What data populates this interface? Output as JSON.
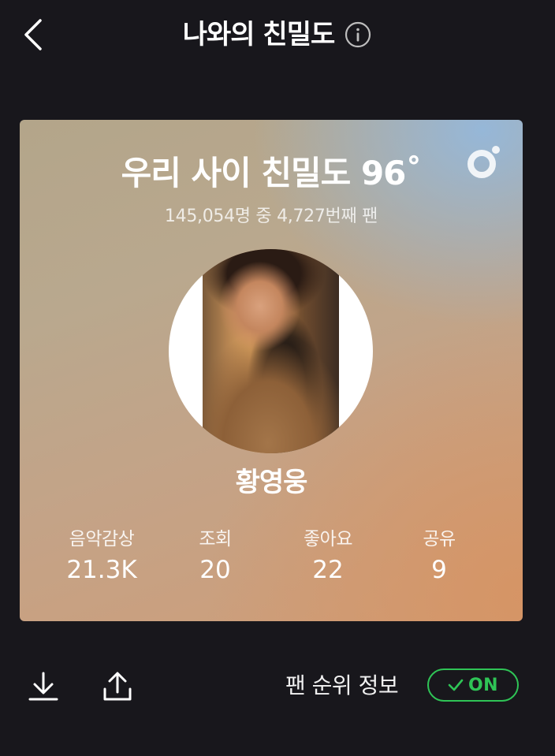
{
  "header": {
    "title": "나와의 친밀도",
    "back_icon": "chevron-left-icon",
    "info_icon": "info-icon"
  },
  "card": {
    "headline": "우리 사이 친밀도 96˚",
    "subtitle": "145,054명 중 4,727번째 팬",
    "badge_icon": "brand-logo-icon",
    "artist_name": "황영웅",
    "stats": [
      {
        "label": "음악감상",
        "value": "21.3K"
      },
      {
        "label": "조회",
        "value": "20"
      },
      {
        "label": "좋아요",
        "value": "22"
      },
      {
        "label": "공유",
        "value": "9"
      }
    ]
  },
  "bottom": {
    "download_icon": "download-icon",
    "share_icon": "share-icon",
    "fan_rank_label": "팬 순위 정보",
    "toggle_label": "ON",
    "toggle_icon": "check-icon"
  },
  "colors": {
    "background": "#18171c",
    "accent_green": "#2fc456"
  }
}
